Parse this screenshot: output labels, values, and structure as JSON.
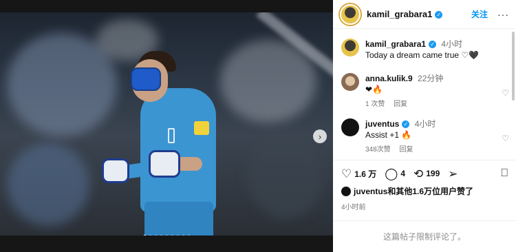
{
  "post": {
    "author": "kamil_grabara1",
    "follow_label": "关注",
    "more_label": "···",
    "caption": {
      "author": "kamil_grabara1",
      "time": "4小时",
      "text": "Today a dream came true",
      "emojis": "♡🖤"
    }
  },
  "comments": [
    {
      "user": "anna.kulik.9",
      "time": "22分钟",
      "text": "❤🔥",
      "likes": "1 次赞",
      "reply": "回复",
      "verified": false
    },
    {
      "user": "juventus",
      "time": "4小时",
      "text": "Assist +1 🔥",
      "likes": "348次赞",
      "reply": "回复",
      "verified": true
    }
  ],
  "actions": {
    "like_count": "1.6 万",
    "comment_count": "4",
    "repost_count": "199"
  },
  "liked_by": "juventus和其他1.6万位用户赞了",
  "posted_ago": "4小时前",
  "comments_limited": "这篇帖子限制评论了。",
  "media": {
    "image_count": 9,
    "current_image": 1,
    "next_icon": "chevron-right-icon"
  },
  "colors": {
    "accent": "#0095f6",
    "verified": "#1d9bf0",
    "photo_bg": "#161616"
  }
}
